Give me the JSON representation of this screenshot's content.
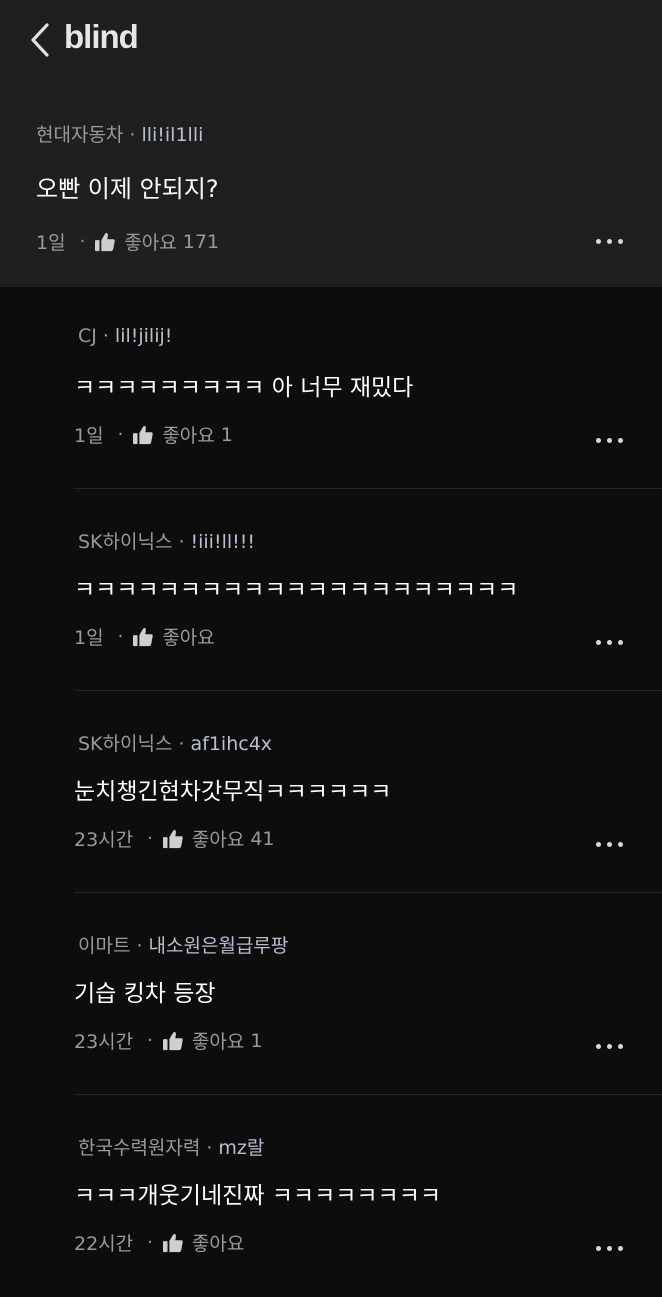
{
  "header": {
    "back_icon": "chevron-left-icon",
    "logo": "blind"
  },
  "post": {
    "company": "현대자동차",
    "nickname": "lli!il1lli",
    "title": "오빤 이제 안되지?",
    "time": "1일",
    "like_label": "좋아요",
    "like_count": "171"
  },
  "comments": [
    {
      "company": "CJ",
      "nickname": "lil!jilij!",
      "text": "ㅋㅋㅋㅋㅋㅋㅋㅋㅋ 아 너무 재밌다",
      "time": "1일",
      "like_label": "좋아요",
      "like_count": "1"
    },
    {
      "company": "SK하이닉스",
      "nickname": "!iii!ll!!!",
      "text": "ㅋㅋㅋㅋㅋㅋㅋㅋㅋㅋㅋㅋㅋㅋㅋㅋㅋㅋㅋㅋㅋ",
      "time": "1일",
      "like_label": "좋아요",
      "like_count": ""
    },
    {
      "company": "SK하이닉스",
      "nickname": "af1ihc4x",
      "text": "눈치챙긴현차갓무직ㅋㅋㅋㅋㅋㅋ",
      "time": "23시간",
      "like_label": "좋아요",
      "like_count": "41"
    },
    {
      "company": "이마트",
      "nickname": "내소원은월급루팡",
      "text": "기습 킹차 등장",
      "time": "23시간",
      "like_label": "좋아요",
      "like_count": "1"
    },
    {
      "company": "한국수력원자력",
      "nickname": "mz랄",
      "text": "ㅋㅋㅋ개웃기네진짜 ㅋㅋㅋㅋㅋㅋㅋㅋ",
      "time": "22시간",
      "like_label": "좋아요",
      "like_count": ""
    }
  ],
  "colors": {
    "post_background": "#1f1f1f",
    "page_background": "#0d0d0d",
    "nickname": "#b9bfcf"
  }
}
